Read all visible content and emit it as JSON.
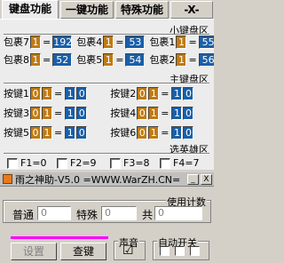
{
  "tabs": [
    {
      "label": "键盘功能"
    },
    {
      "label": "一键功能"
    },
    {
      "label": "特殊功能"
    },
    {
      "label": "-X-"
    }
  ],
  "small_keypad": {
    "title": "小键盘区",
    "slots": [
      {
        "label": "包裹7",
        "key1": "1",
        "eq": "=",
        "value": "192"
      },
      {
        "label": "包裹4",
        "key1": "1",
        "eq": "=",
        "value": "53"
      },
      {
        "label": "包裹1",
        "key1": "1",
        "eq": "=",
        "value": "55"
      },
      {
        "label": "包裹8",
        "key1": "1",
        "eq": "=",
        "value": "52"
      },
      {
        "label": "包裹5",
        "key1": "1",
        "eq": "=",
        "value": "54"
      },
      {
        "label": "包裹2",
        "key1": "1",
        "eq": "=",
        "value": "56"
      }
    ]
  },
  "main_keypad": {
    "title": "主键盘区",
    "keys": [
      {
        "label": "按键1",
        "a": "0",
        "b": "1",
        "eq": "=",
        "c": "1",
        "d": "0"
      },
      {
        "label": "按键2",
        "a": "0",
        "b": "1",
        "eq": "=",
        "c": "1",
        "d": "0"
      },
      {
        "label": "按键3",
        "a": "0",
        "b": "1",
        "eq": "=",
        "c": "1",
        "d": "0"
      },
      {
        "label": "按键4",
        "a": "0",
        "b": "1",
        "eq": "=",
        "c": "1",
        "d": "0"
      },
      {
        "label": "按键5",
        "a": "0",
        "b": "1",
        "eq": "=",
        "c": "1",
        "d": "0"
      },
      {
        "label": "按键6",
        "a": "0",
        "b": "1",
        "eq": "=",
        "c": "1",
        "d": "0"
      }
    ]
  },
  "hero_select": {
    "title": "选英雄区",
    "options": [
      {
        "label": "F1=0"
      },
      {
        "label": "F2=9"
      },
      {
        "label": "F3=8"
      },
      {
        "label": "F4=7"
      }
    ]
  },
  "window2": {
    "title": "雨之神助-V5.0  =WWW.WarZH.CN=",
    "min_label": "_",
    "close_label": "X"
  },
  "counter": {
    "title": "使用计数",
    "normal_label": "普通",
    "normal_value": "0",
    "special_label": "特殊",
    "special_value": "0",
    "total_label": "共",
    "total_value": "0"
  },
  "buttons": {
    "settings": "设置",
    "lookup": "查键"
  },
  "sound": {
    "title": "声音",
    "check": "☑"
  },
  "auto_switch": {
    "title": "自动开关"
  },
  "colors": {
    "accent_blue": "#1a5fa8",
    "accent_orange": "#c07a10",
    "pink_bar": "#ff00ff"
  }
}
